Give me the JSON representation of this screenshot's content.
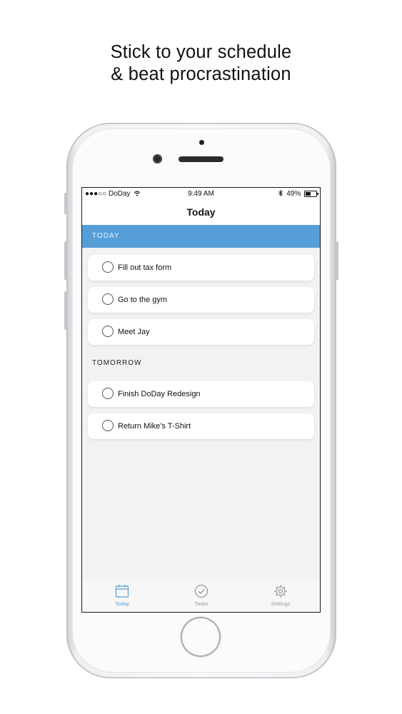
{
  "headline": {
    "line1": "Stick to your schedule",
    "line2": "& beat procrastination"
  },
  "status_bar": {
    "carrier": "●●●○○ DoDay",
    "time": "9:49 AM",
    "battery_text": "49%",
    "battery_level": 0.49
  },
  "nav": {
    "title": "Today"
  },
  "sections": {
    "today": "TODAY",
    "tomorrow": "TOMORROW"
  },
  "tasks_today": [
    {
      "label": "Fill out tax form"
    },
    {
      "label": "Go to the gym"
    },
    {
      "label": "Meet Jay"
    }
  ],
  "tasks_tomorrow": [
    {
      "label": "Finish DoDay Redesign"
    },
    {
      "label": "Return Mike's T-Shirt"
    }
  ],
  "tabs": [
    {
      "label": "Today",
      "icon": "calendar-icon",
      "active": true
    },
    {
      "label": "Tasks",
      "icon": "checkmark-circle-icon",
      "active": false
    },
    {
      "label": "Settings",
      "icon": "gear-icon",
      "active": false
    }
  ],
  "colors": {
    "accent": "#559ed8",
    "inactive_tab": "#9a9a9e"
  }
}
